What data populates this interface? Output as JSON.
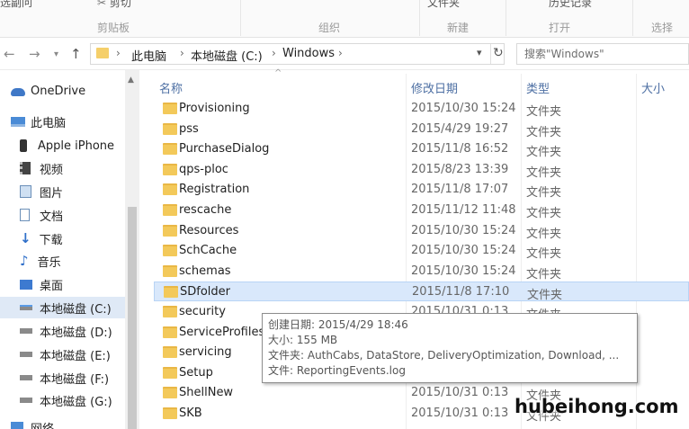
{
  "ribbon": {
    "top_left": "选副问",
    "top_cut": "剪切",
    "top_new": "文件夹",
    "top_history": "历史记录",
    "groups": [
      "剪贴板",
      "组织",
      "新建",
      "打开",
      "选择"
    ]
  },
  "address": {
    "crumbs": [
      "此电脑",
      "本地磁盘 (C:)",
      "Windows"
    ],
    "search_placeholder": "搜索\"Windows\""
  },
  "sidebar": {
    "items": [
      {
        "label": "OneDrive",
        "icon": "cloud-icon"
      },
      {
        "label": "此电脑",
        "icon": "computer-icon"
      },
      {
        "label": "Apple iPhone",
        "icon": "phone-icon"
      },
      {
        "label": "视频",
        "icon": "video-icon"
      },
      {
        "label": "图片",
        "icon": "pictures-icon"
      },
      {
        "label": "文档",
        "icon": "documents-icon"
      },
      {
        "label": "下载",
        "icon": "download-icon"
      },
      {
        "label": "音乐",
        "icon": "music-icon"
      },
      {
        "label": "桌面",
        "icon": "desktop-icon"
      },
      {
        "label": "本地磁盘 (C:)",
        "icon": "drive-icon"
      },
      {
        "label": "本地磁盘 (D:)",
        "icon": "drive-icon"
      },
      {
        "label": "本地磁盘 (E:)",
        "icon": "drive-icon"
      },
      {
        "label": "本地磁盘 (F:)",
        "icon": "drive-icon"
      },
      {
        "label": "本地磁盘 (G:)",
        "icon": "drive-icon"
      },
      {
        "label": "网络",
        "icon": "network-icon"
      }
    ]
  },
  "columns": {
    "name": "名称",
    "date": "修改日期",
    "type": "类型",
    "size": "大小"
  },
  "files": [
    {
      "name": "Provisioning",
      "date": "2015/10/30 15:24",
      "type": "文件夹"
    },
    {
      "name": "pss",
      "date": "2015/4/29 19:27",
      "type": "文件夹"
    },
    {
      "name": "PurchaseDialog",
      "date": "2015/11/8 16:52",
      "type": "文件夹"
    },
    {
      "name": "qps-ploc",
      "date": "2015/8/23 13:39",
      "type": "文件夹"
    },
    {
      "name": "Registration",
      "date": "2015/11/8 17:07",
      "type": "文件夹"
    },
    {
      "name": "rescache",
      "date": "2015/11/12 11:48",
      "type": "文件夹"
    },
    {
      "name": "Resources",
      "date": "2015/10/30 15:24",
      "type": "文件夹"
    },
    {
      "name": "SchCache",
      "date": "2015/10/30 15:24",
      "type": "文件夹"
    },
    {
      "name": "schemas",
      "date": "2015/10/30 15:24",
      "type": "文件夹"
    },
    {
      "name": "SDfolder",
      "date": "2015/11/8 17:10",
      "type": "文件夹"
    },
    {
      "name": "security",
      "date": "2015/10/31 0:13",
      "type": "文件夹"
    },
    {
      "name": "ServiceProfiles",
      "date": "",
      "type": ""
    },
    {
      "name": "servicing",
      "date": "",
      "type": ""
    },
    {
      "name": "Setup",
      "date": "",
      "type": ""
    },
    {
      "name": "ShellNew",
      "date": "2015/10/31 0:13",
      "type": "文件夹"
    },
    {
      "name": "SKB",
      "date": "2015/10/31 0:13",
      "type": "文件夹"
    }
  ],
  "selected_file": "SDfolder",
  "tooltip": {
    "created": "创建日期: 2015/4/29 18:46",
    "size": "大小: 155 MB",
    "folders": "文件夹: AuthCabs, DataStore, DeliveryOptimization, Download, ...",
    "files": "文件: ReportingEvents.log"
  },
  "watermark": "hubeihong.com",
  "colors": {
    "selection": "#d9e8fb",
    "folder": "#f3c95a",
    "header_text": "#4d6fa3"
  }
}
